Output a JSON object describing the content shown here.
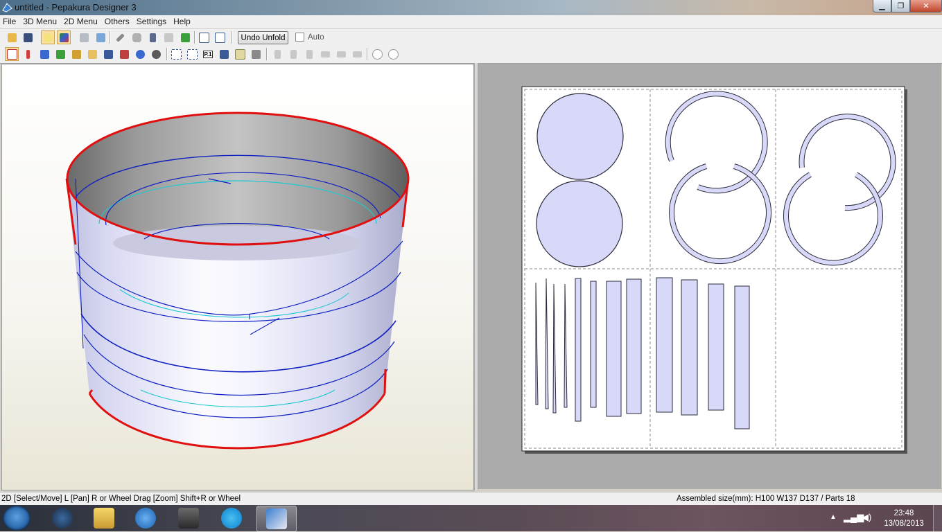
{
  "window": {
    "title": "untitled - Pepakura Designer 3"
  },
  "menu": [
    "File",
    "3D Menu",
    "2D Menu",
    "Others",
    "Settings",
    "Help"
  ],
  "toolbar1": {
    "icons": [
      "open-icon",
      "save-icon",
      "light-icon",
      "texture-icon",
      "cube-icon",
      "box-icon",
      "pencil-icon",
      "cylinder-icon",
      "anchor-icon",
      "display-icon",
      "refresh-icon",
      "window-icon",
      "window2-icon"
    ],
    "undo_unfold_label": "Undo Unfold",
    "auto_label": "Auto",
    "auto_checked": false
  },
  "toolbar2": {
    "icons": [
      "select-icon",
      "edge-icon",
      "grid-icon",
      "join-icon",
      "flap-icon",
      "text-icon",
      "image-icon",
      "paint-icon",
      "rotate-icon",
      "rotate-back-icon",
      "fit-icon",
      "zoom-icon",
      "page-icon",
      "arrange-icon",
      "layout-icon",
      "print-icon",
      "align-left-icon",
      "align-center-icon",
      "align-right-icon",
      "align-top-icon",
      "align-middle-icon",
      "align-bottom-icon",
      "rotate-90-left-icon",
      "rotate-90-right-icon"
    ],
    "page_label": "P.1"
  },
  "status": {
    "left": "2D [Select/Move] L [Pan] R or Wheel Drag [Zoom] Shift+R or Wheel",
    "right": "Assembled size(mm): H100 W137 D137 / Parts 18"
  },
  "taskbar": {
    "apps": [
      "hp-icon",
      "explorer-icon",
      "internet-explorer-icon",
      "gimp-icon",
      "skype-icon",
      "pepakura-icon"
    ],
    "time": "23:48",
    "date": "13/08/2013"
  },
  "colors": {
    "part_fill": "#d8d8f8",
    "outline": "#2a2a3a",
    "cut_edge": "#e01010",
    "fold_line": "#1020c0",
    "accent_line": "#20c8d0"
  }
}
